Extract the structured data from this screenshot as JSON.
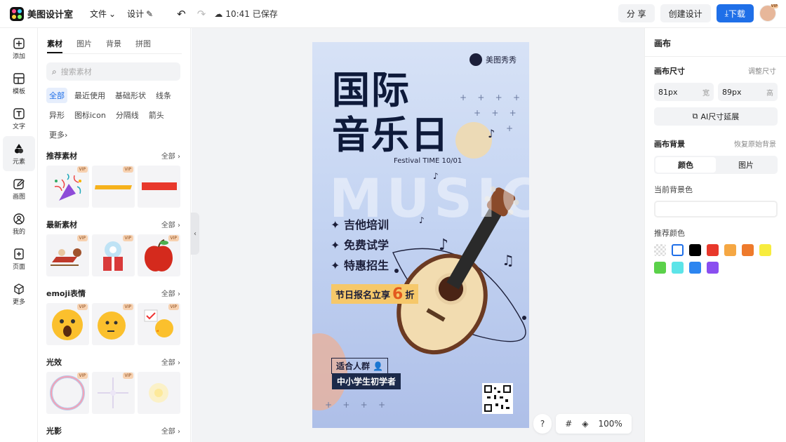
{
  "app": {
    "name": "美图设计室"
  },
  "topbar": {
    "file_menu": "文件",
    "design_menu": "设计",
    "save_status": "10:41 已保存",
    "share": "分 享",
    "create": "创建设计",
    "download": "下载",
    "avatar_badge": "VIP"
  },
  "rail": [
    {
      "label": "添加",
      "icon": "plus-square-icon"
    },
    {
      "label": "模板",
      "icon": "template-icon"
    },
    {
      "label": "文字",
      "icon": "text-icon"
    },
    {
      "label": "元素",
      "icon": "shapes-icon"
    },
    {
      "label": "画图",
      "icon": "pencil-icon"
    },
    {
      "label": "我的",
      "icon": "user-icon"
    },
    {
      "label": "页面",
      "icon": "page-add-icon"
    },
    {
      "label": "更多",
      "icon": "cube-icon"
    }
  ],
  "panel": {
    "tabs": [
      "素材",
      "图片",
      "背景",
      "拼图"
    ],
    "search_placeholder": "搜索素材",
    "chips": [
      "全部",
      "最近使用",
      "基础形状",
      "线条",
      "异形",
      "图标icon",
      "分隔线",
      "箭头",
      "更多"
    ],
    "all_label": "全部",
    "vip": "VIP",
    "sections": [
      "推荐素材",
      "最新素材",
      "emoji表情",
      "光效",
      "光影"
    ]
  },
  "poster": {
    "brand": "美图秀秀",
    "title_line1": "国际",
    "title_line2": "音乐日",
    "subtitle": "Festival TIME 10/01",
    "bg_word": "MUSIC",
    "items": [
      "吉他培训",
      "免费试学",
      "特惠招生"
    ],
    "offer_prefix": "节日报名立享",
    "offer_num": "6",
    "offer_suffix": "折",
    "audience_label": "适合人群",
    "audience": "中小学生初学者"
  },
  "canvas_controls": {
    "help": "?",
    "zoom": "100%"
  },
  "right_panel": {
    "title": "画布",
    "size_label": "画布尺寸",
    "size_action": "调整尺寸",
    "width_value": "81px",
    "width_unit": "宽",
    "height_value": "89px",
    "height_unit": "高",
    "ai_extend": "AI尺寸延展",
    "bg_label": "画布背景",
    "bg_reset": "恢复原始背景",
    "seg_color": "颜色",
    "seg_image": "图片",
    "current_bg": "当前背景色",
    "recommended": "推荐颜色",
    "swatch_colors": [
      "transparent",
      "#ffffff",
      "#000000",
      "#e8382b",
      "#f5a743",
      "#ee7a2c",
      "#f7ec3e",
      "#5bd14a",
      "#5ce4e8",
      "#2c85f0",
      "#8a4ef0"
    ]
  }
}
